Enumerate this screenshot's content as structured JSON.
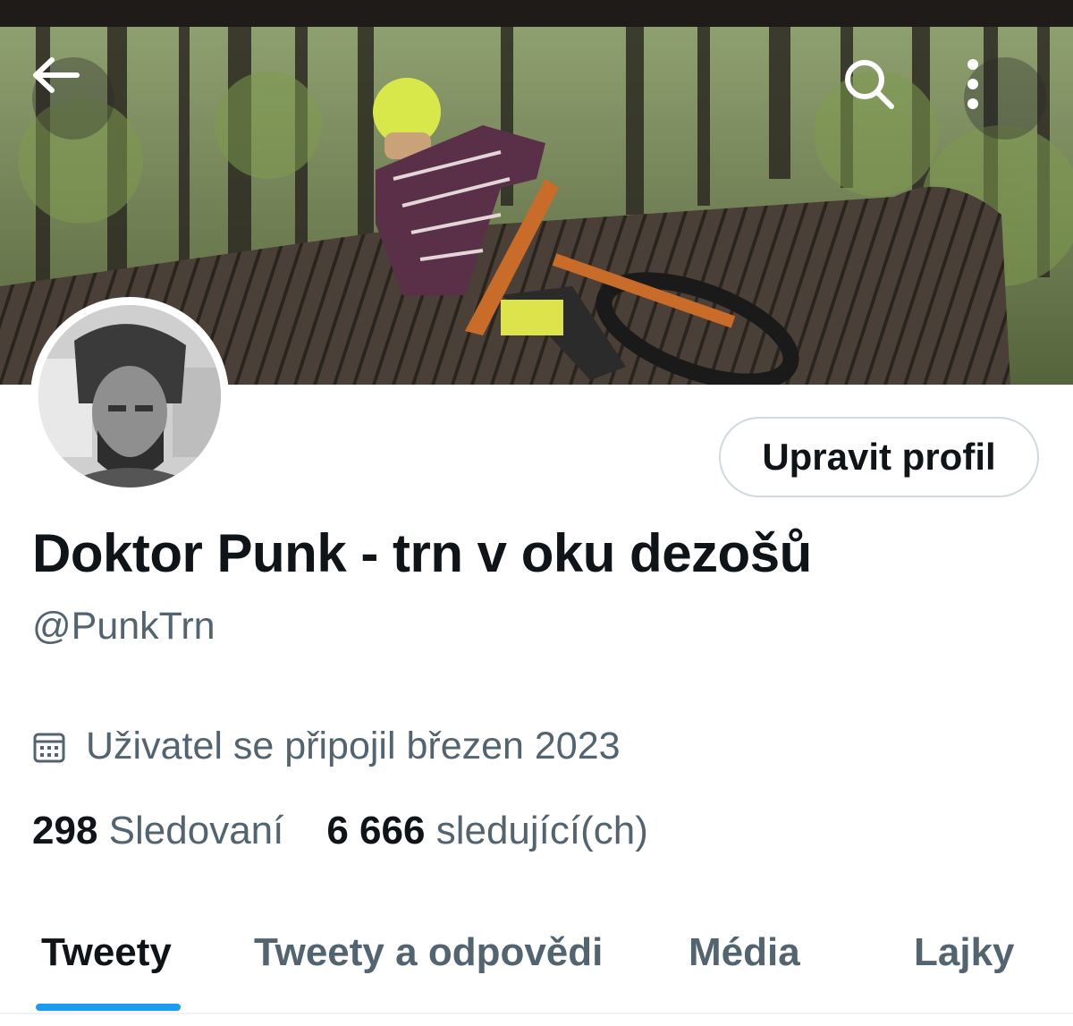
{
  "profile": {
    "display_name": "Doktor Punk - trn v oku dezošů",
    "handle": "@PunkTrn",
    "joined": "Uživatel se připojil březen 2023",
    "edit_button": "Upravit profil"
  },
  "stats": {
    "following_count": "298",
    "following_label": "Sledovaní",
    "followers_count": "6 666",
    "followers_label": "sledující(ch)"
  },
  "tabs": [
    {
      "label": "Tweety",
      "active": true
    },
    {
      "label": "Tweety a odpovědi",
      "active": false
    },
    {
      "label": "Média",
      "active": false
    },
    {
      "label": "Lajky",
      "active": false
    }
  ],
  "icons": {
    "back": "arrow-left-icon",
    "search": "search-icon",
    "more": "more-vertical-icon",
    "calendar": "calendar-icon"
  },
  "colors": {
    "accent": "#1d9bf0",
    "text_primary": "#0f1419",
    "text_secondary": "#536471"
  }
}
